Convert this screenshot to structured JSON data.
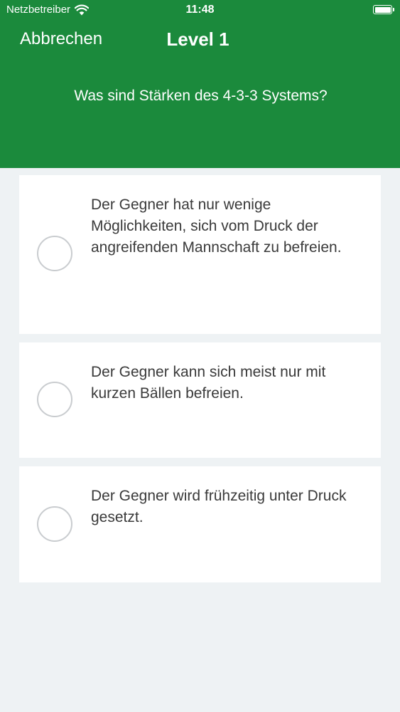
{
  "status_bar": {
    "carrier": "Netzbetreiber",
    "time": "11:48",
    "wifi_icon": "wifi-icon",
    "battery_icon": "battery-icon",
    "battery_level": 1.0
  },
  "nav": {
    "cancel_label": "Abbrechen",
    "title": "Level 1"
  },
  "question": "Was sind Stärken des 4-3-3 Systems?",
  "answers": [
    {
      "text": "Der Gegner hat nur wenige Möglichkeiten, sich vom Druck der angreifenden Mannschaft zu befreien.",
      "selected": false
    },
    {
      "text": "Der Gegner kann sich meist nur mit kurzen Bällen befreien.",
      "selected": false
    },
    {
      "text": "Der Gegner wird frühzeitig unter Druck gesetzt.",
      "selected": false
    }
  ],
  "colors": {
    "header_bg": "#1b8a3c",
    "page_bg": "#eef2f4",
    "card_bg": "#ffffff",
    "radio_border": "#c9cccf",
    "answer_text": "#3a3a3a"
  }
}
